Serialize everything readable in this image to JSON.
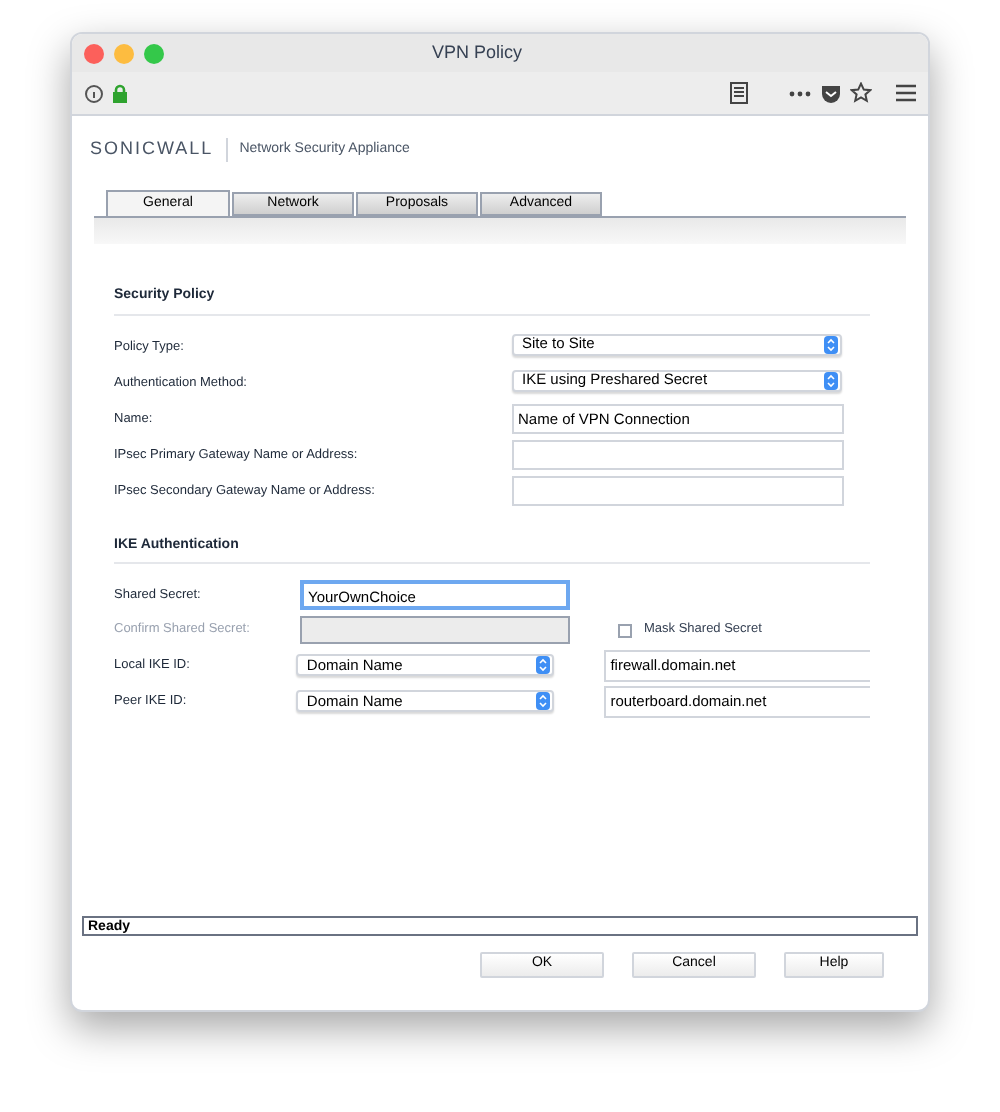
{
  "window": {
    "title": "VPN Policy"
  },
  "brand": {
    "logo": "SONICWALL",
    "product": "Network Security Appliance"
  },
  "tabs": [
    {
      "label": "General",
      "selected": true
    },
    {
      "label": "Network",
      "selected": false
    },
    {
      "label": "Proposals",
      "selected": false
    },
    {
      "label": "Advanced",
      "selected": false
    }
  ],
  "security_policy": {
    "heading": "Security Policy",
    "rows": [
      {
        "label": "Policy Type:",
        "kind": "select",
        "value": "Site to Site"
      },
      {
        "label": "Authentication Method:",
        "kind": "select",
        "value": "IKE using Preshared Secret"
      },
      {
        "label": "Name:",
        "kind": "text",
        "value": "Name of VPN Connection"
      },
      {
        "label": "IPsec Primary Gateway Name or Address:",
        "kind": "text"
      },
      {
        "label": "IPsec Secondary Gateway Name or Address:",
        "kind": "text"
      }
    ]
  },
  "ike_authentication": {
    "heading": "IKE Authentication",
    "shared_secret": {
      "label": "Shared Secret:",
      "value": "YourOwnChoice",
      "focused": true
    },
    "confirm_secret": {
      "label": "Confirm Shared Secret:",
      "disabled": true
    },
    "mask_secret": {
      "label": "Mask Shared Secret",
      "checked": false
    },
    "ids": [
      {
        "label": "Local IKE ID:",
        "type": "Domain Name",
        "value": "firewall.domain.net"
      },
      {
        "label": "Peer IKE ID:",
        "type": "Domain Name",
        "value": "routerboard.domain.net"
      }
    ]
  },
  "status_bar": "Ready",
  "buttons": [
    "OK",
    "Cancel",
    "Help"
  ]
}
